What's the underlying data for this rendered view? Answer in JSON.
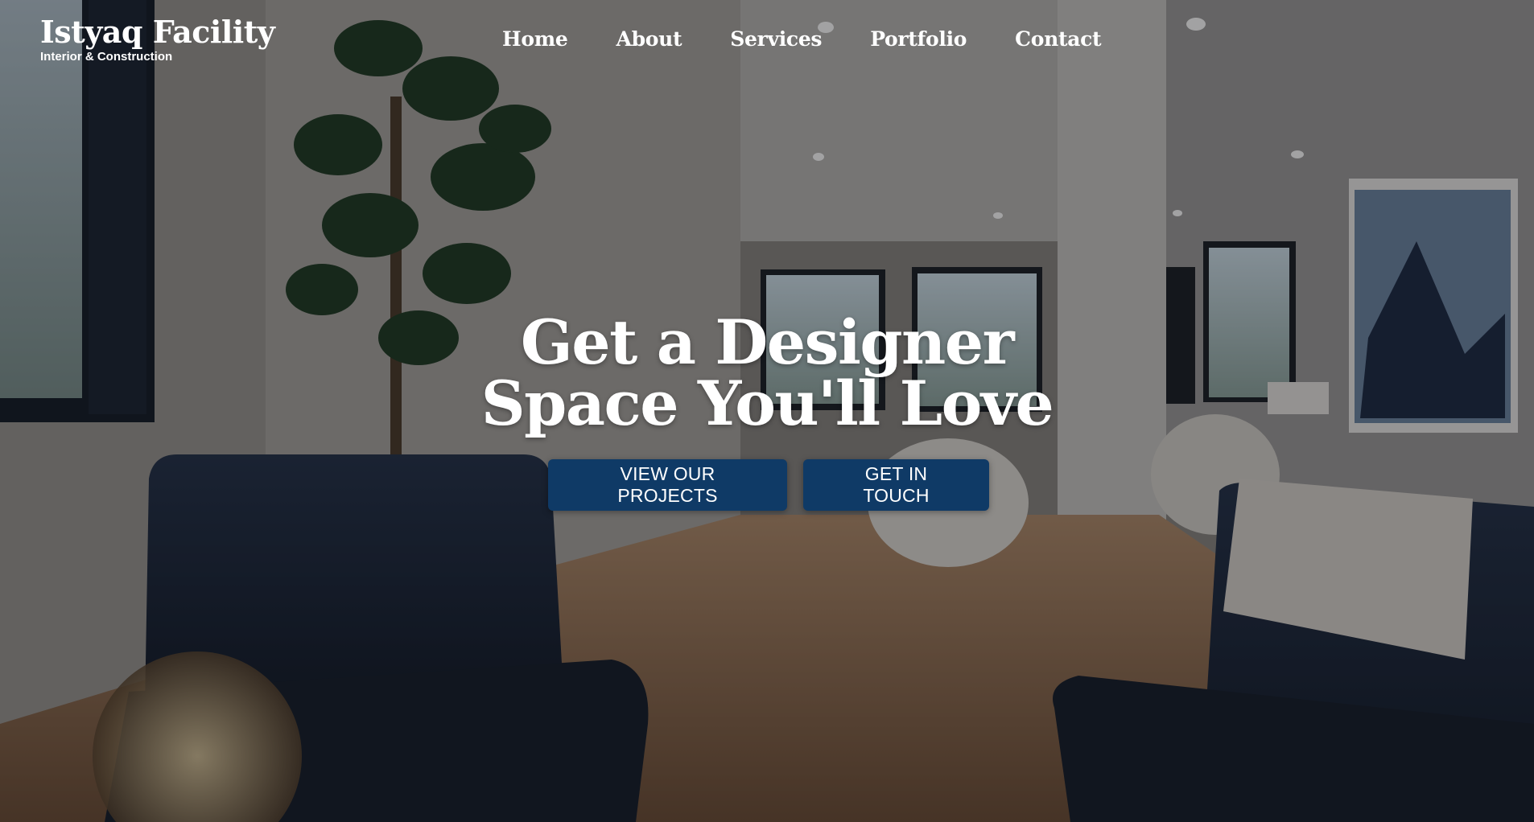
{
  "brand": {
    "title": "Istyaq Facility",
    "subtitle": "Interior & Construction"
  },
  "nav": {
    "items": [
      "Home",
      "About",
      "Services",
      "Portfolio",
      "Contact"
    ]
  },
  "hero": {
    "headline_line1": "Get a Designer",
    "headline_line2": "Space You'll Love",
    "primary_button": "VIEW OUR PROJECTS",
    "secondary_button": "GET IN TOUCH",
    "background_image": "interior-living-room-photo"
  },
  "colors": {
    "button_bg": "#0f3a66",
    "text": "#ffffff"
  }
}
